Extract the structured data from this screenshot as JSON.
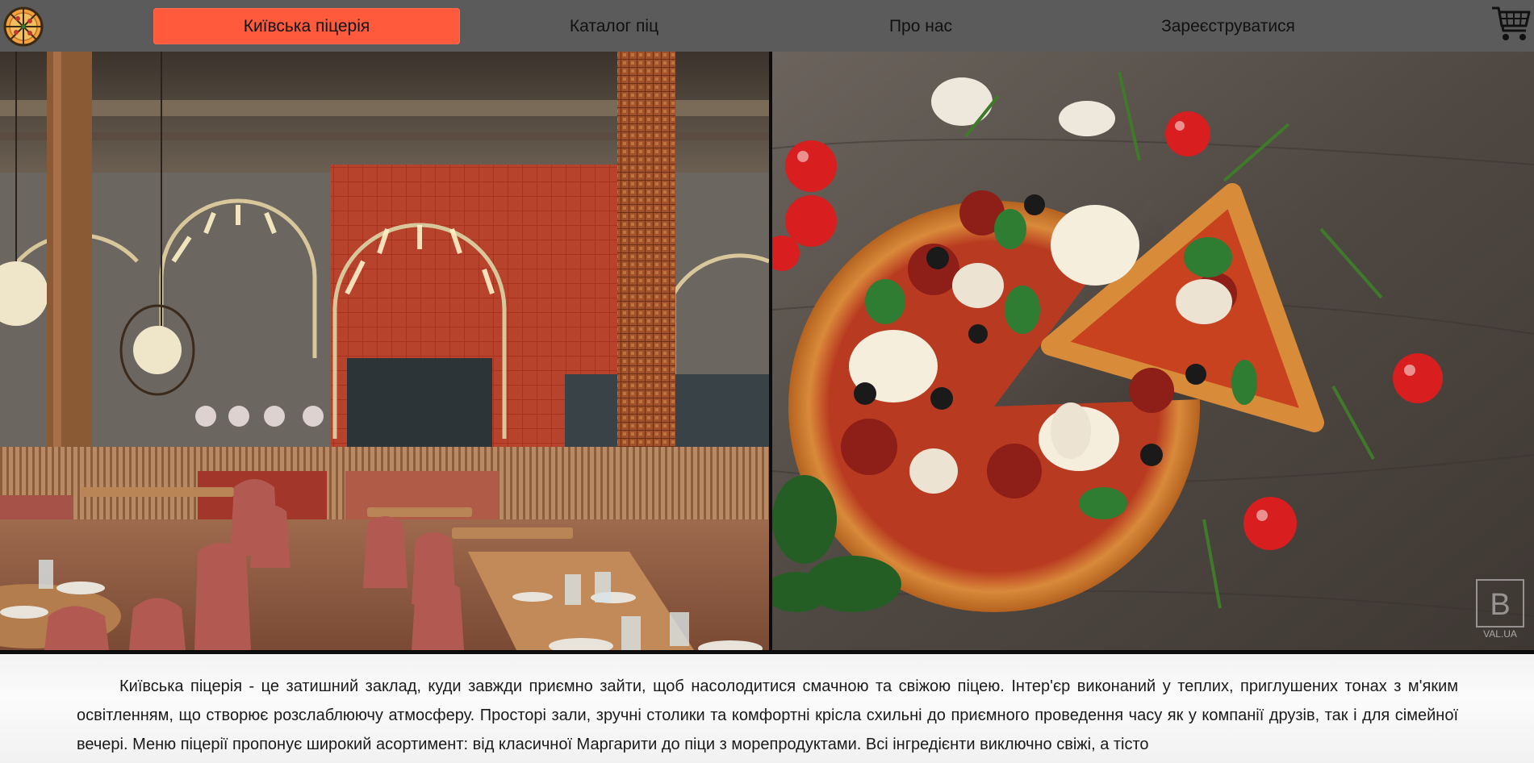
{
  "nav": {
    "items": [
      {
        "label": "Київська піцерія",
        "active": true
      },
      {
        "label": "Каталог піц",
        "active": false
      },
      {
        "label": "Про нас",
        "active": false
      },
      {
        "label": "Зареєструватися",
        "active": false
      }
    ],
    "logo_icon": "pizza-logo-icon",
    "cart_icon": "shopping-cart-icon"
  },
  "hero": {
    "left_image": "restaurant-interior",
    "right_image": "pizza-photo",
    "watermark": "VAL.UA"
  },
  "main": {
    "description": "Київська піцерія - це затишний заклад, куди завжди приємно зайти, щоб насолодитися смачною та свіжою піцею. Інтер'єр виконаний у теплих, приглушених тонах з м'яким освітленням, що створює розслаблюючу атмосферу. Просторі зали, зручні столики та комфортні крісла схильні до приємного проведення часу як у компанії друзів, так і для сімейної вечері. Меню піцерії пропонує широкий асортимент: від класичної Маргарити до піци з морепродуктами. Всі інгредієнти виключно свіжі, а тісто"
  },
  "colors": {
    "nav_bg": "#5b5b5b",
    "accent": "#ff5a3c"
  }
}
